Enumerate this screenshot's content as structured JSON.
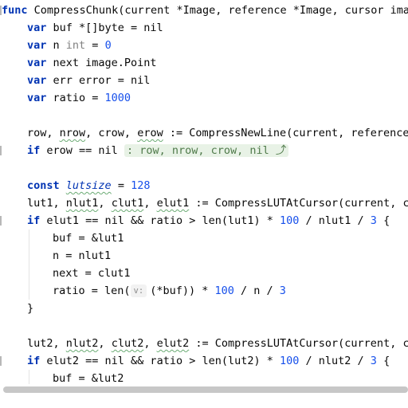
{
  "code": {
    "l0": {
      "a": "func",
      "b": " CompressChunk(current *Image, reference *Image, cursor image"
    },
    "l1": {
      "a": "var",
      "b": " buf *[]byte = nil"
    },
    "l2": {
      "a": "var",
      "b": " n ",
      "c": "int",
      "d": " = ",
      "e": "0"
    },
    "l3": {
      "a": "var",
      "b": " next image.Point"
    },
    "l4": {
      "a": "var",
      "b": " err error = nil"
    },
    "l5": {
      "a": "var",
      "b": " ratio = ",
      "c": "1000"
    },
    "l7": {
      "a": "row, ",
      "b": "nrow",
      "c": ", crow, ",
      "d": "erow",
      "e": " := CompressNewLine(current, reference,"
    },
    "l8": {
      "a": "if",
      "b": " erow == nil ",
      "c": ": row, nrow, crow, nil ⤴"
    },
    "l10": {
      "a": "const",
      "b": " ",
      "c": "lutsize",
      "d": " = ",
      "e": "128"
    },
    "l11": {
      "a": "lut1, ",
      "b": "nlut1",
      "c": ", ",
      "d": "clut1",
      "e": ", ",
      "f": "elut1",
      "g": " := CompressLUTAtCursor(current, cu"
    },
    "l12": {
      "a": "if",
      "b": " elut1 == nil && ratio > len(lut1) * ",
      "c": "100",
      "d": " / nlut1 / ",
      "e": "3",
      "f": " {"
    },
    "l13": {
      "a": "buf = &lut1"
    },
    "l14": {
      "a": "n = nlut1"
    },
    "l15": {
      "a": "next = clut1"
    },
    "l16": {
      "a": "ratio = len(",
      "hint": "v:",
      "b": "(*buf)) * ",
      "c": "100",
      "d": " / n / ",
      "e": "3"
    },
    "l17": {
      "a": "}"
    },
    "l19": {
      "a": "lut2, ",
      "b": "nlut2",
      "c": ", ",
      "d": "clut2",
      "e": ", ",
      "f": "elut2",
      "g": " := CompressLUTAtCursor(current, cu"
    },
    "l20": {
      "a": "if",
      "b": " elut2 == nil && ratio > len(lut2) * ",
      "c": "100",
      "d": " / nlut2 / ",
      "e": "3",
      "f": " {"
    },
    "l21": {
      "a": "buf = &lut2"
    }
  },
  "colors": {
    "keyword": "#0033b3",
    "number": "#1750eb",
    "type": "#808080",
    "hint_bg": "#e8f2e6",
    "hint_fg": "#4f7a4a"
  }
}
